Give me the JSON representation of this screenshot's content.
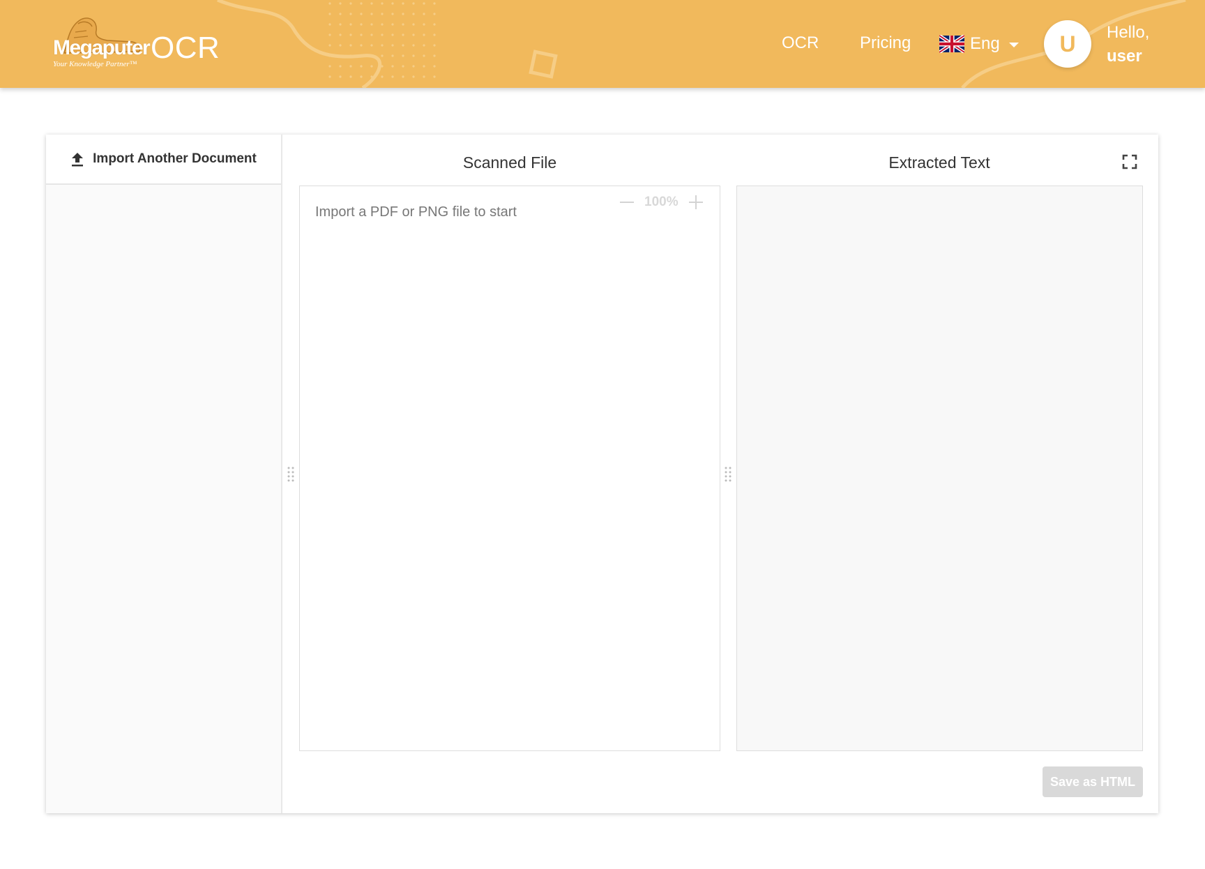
{
  "header": {
    "brand": {
      "wordmark": "Megaputer",
      "tagline": "Your Knowledge Partner™",
      "app_name": "OCR"
    },
    "nav": {
      "ocr": "OCR",
      "pricing": "Pricing"
    },
    "language": {
      "label": "Eng",
      "flag_icon": "uk-flag-icon"
    },
    "user": {
      "avatar_letter": "U",
      "greeting": "Hello,",
      "name": "user"
    },
    "colors": {
      "bar": "#f1b95c",
      "text": "#ffffff"
    }
  },
  "sidebar": {
    "import_label": "Import Another Document"
  },
  "scanned_panel": {
    "title": "Scanned File",
    "placeholder": "Import a PDF or PNG file to start",
    "zoom": "100%"
  },
  "text_panel": {
    "title": "Extracted Text"
  },
  "actions": {
    "save_label": "Save as HTML"
  }
}
